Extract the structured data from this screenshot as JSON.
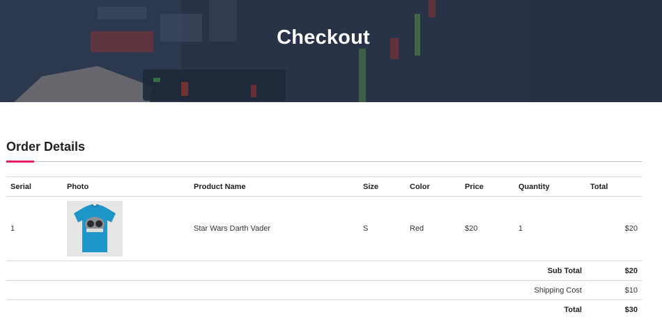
{
  "hero": {
    "title": "Checkout"
  },
  "section": {
    "title": "Order Details"
  },
  "table": {
    "headers": [
      "Serial",
      "Photo",
      "Product Name",
      "Size",
      "Color",
      "Price",
      "Quantity",
      "Total"
    ],
    "rows": [
      {
        "serial": "1",
        "photo_icon": "tshirt-image",
        "product_name": "Star Wars Darth Vader",
        "size": "S",
        "color": "Red",
        "price": "$20",
        "quantity": "1",
        "total": "$20"
      }
    ],
    "summary": {
      "sub_total_label": "Sub Total",
      "sub_total_value": "$20",
      "shipping_label": "Shipping Cost",
      "shipping_value": "$10",
      "total_label": "Total",
      "total_value": "$30"
    }
  },
  "colors": {
    "accent": "#e91e63",
    "hero_bg": "#2f3a4c",
    "shirt": "#1e96c8"
  }
}
